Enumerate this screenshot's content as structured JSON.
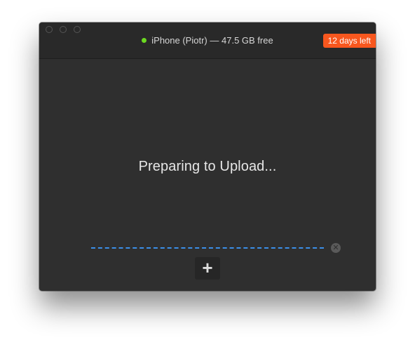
{
  "window": {
    "device": {
      "name": "iPhone (Piotr)",
      "separator": "—",
      "free_space": "47.5 GB free",
      "status_color": "#6cd921"
    },
    "trial": {
      "label": "12 days left",
      "color": "#f8571e"
    }
  },
  "main": {
    "status": "Preparing to Upload...",
    "progress_color": "#3b8fe8"
  },
  "controls": {
    "cancel_icon": "x-circle-icon",
    "cancel_glyph": "✕",
    "add_icon": "plus-icon",
    "add_glyph": "+"
  }
}
